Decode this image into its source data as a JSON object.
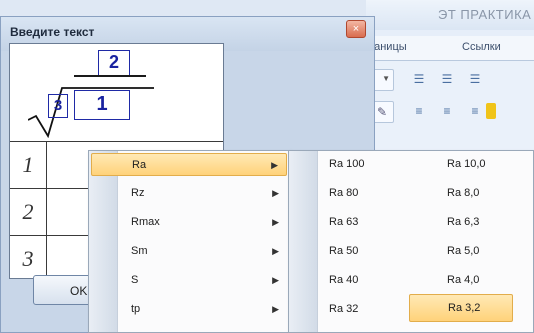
{
  "word": {
    "title": "ЭТ ПРАКТИКА",
    "tabs": [
      "раницы",
      "Ссылки"
    ]
  },
  "dialog": {
    "title": "Введите текст",
    "close_glyph": "×",
    "formula": {
      "top": "2",
      "index": "3",
      "radicand": "1"
    },
    "row_numbers": [
      "1",
      "2",
      "3"
    ],
    "ok_label": "OK"
  },
  "menu1": {
    "items": [
      {
        "label": "Ra",
        "highlighted": true
      },
      {
        "label": "Rz"
      },
      {
        "label": "Rmax"
      },
      {
        "label": "Sm"
      },
      {
        "label": "S"
      },
      {
        "label": "tp"
      }
    ]
  },
  "menu2": {
    "col1": [
      "Ra 100",
      "Ra 80",
      "Ra 63",
      "Ra 50",
      "Ra 40",
      "Ra 32"
    ],
    "col2": [
      "Ra 10,0",
      "Ra 8,0",
      "Ra 6,3",
      "Ra 5,0",
      "Ra 4,0",
      "Ra 3,2"
    ],
    "highlighted": "Ra 3,2"
  },
  "colors": {
    "highlight_top": "#ffe9b5",
    "highlight_bottom": "#ffd27a",
    "formula_blue": "#1f2aa6",
    "close_red": "#d96d4f"
  }
}
